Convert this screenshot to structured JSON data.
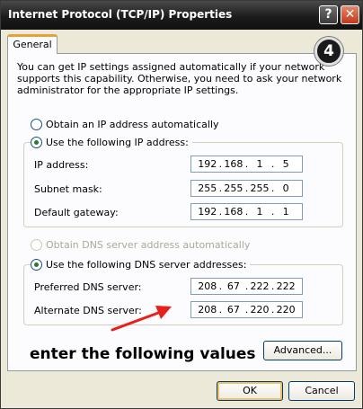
{
  "window": {
    "title": "Internet Protocol (TCP/IP) Properties",
    "help_glyph": "?",
    "close_glyph": "✕"
  },
  "tab": {
    "label": "General"
  },
  "step_badge": "4",
  "intro": "You can get IP settings assigned automatically if your network supports this capability. Otherwise, you need to ask your network administrator for the appropriate IP settings.",
  "ip": {
    "auto_label": "Obtain an IP address automatically",
    "manual_label": "Use the following IP address:",
    "selected": "manual",
    "fields": [
      {
        "label": "IP address:",
        "octets": [
          "192",
          "168",
          "1",
          "5"
        ]
      },
      {
        "label": "Subnet mask:",
        "octets": [
          "255",
          "255",
          "255",
          "0"
        ]
      },
      {
        "label": "Default gateway:",
        "octets": [
          "192",
          "168",
          "1",
          "1"
        ]
      }
    ]
  },
  "dns": {
    "auto_label": "Obtain DNS server address automatically",
    "manual_label": "Use the following DNS server addresses:",
    "selected": "manual",
    "fields": [
      {
        "label": "Preferred DNS server:",
        "octets": [
          "208",
          "67",
          "222",
          "222"
        ]
      },
      {
        "label": "Alternate DNS server:",
        "octets": [
          "208",
          "67",
          "220",
          "220"
        ]
      }
    ]
  },
  "annotation": "enter the following values",
  "buttons": {
    "advanced": "Advanced...",
    "ok": "OK",
    "cancel": "Cancel"
  },
  "colors": {
    "arrow": "#e8201c",
    "title_bar": "#1c1c1c",
    "close_button": "#c2391a"
  }
}
